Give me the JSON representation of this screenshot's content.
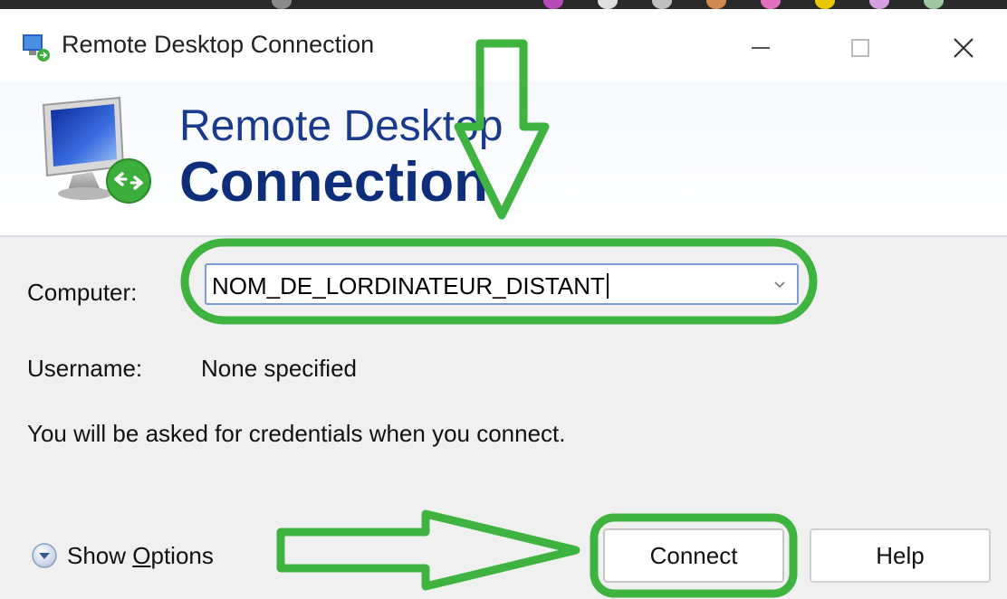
{
  "window": {
    "title": "Remote Desktop Connection",
    "controls": {
      "minimize": "—",
      "maximize": "☐",
      "close": "✕"
    }
  },
  "banner": {
    "line1": "Remote Desktop",
    "line2": "Connection"
  },
  "form": {
    "computer_label": "Computer:",
    "computer_value": "NOM_DE_LORDINATEUR_DISTANT",
    "username_label": "Username:",
    "username_value": "None specified",
    "credentials_note": "You will be asked for credentials when you connect."
  },
  "footer": {
    "show_options_prefix": "Show ",
    "show_options_underlined": "O",
    "show_options_suffix": "ptions",
    "connect_label": "Connect",
    "help_label": "Help"
  },
  "colors": {
    "annotation_green": "#3fb33f",
    "brand_blue": "#1a3a8c",
    "focus_border": "#7a9cd3"
  },
  "icons": [
    "remote-desktop-app-icon",
    "monitor-connect-icon",
    "chevron-down-icon",
    "expand-options-icon"
  ]
}
